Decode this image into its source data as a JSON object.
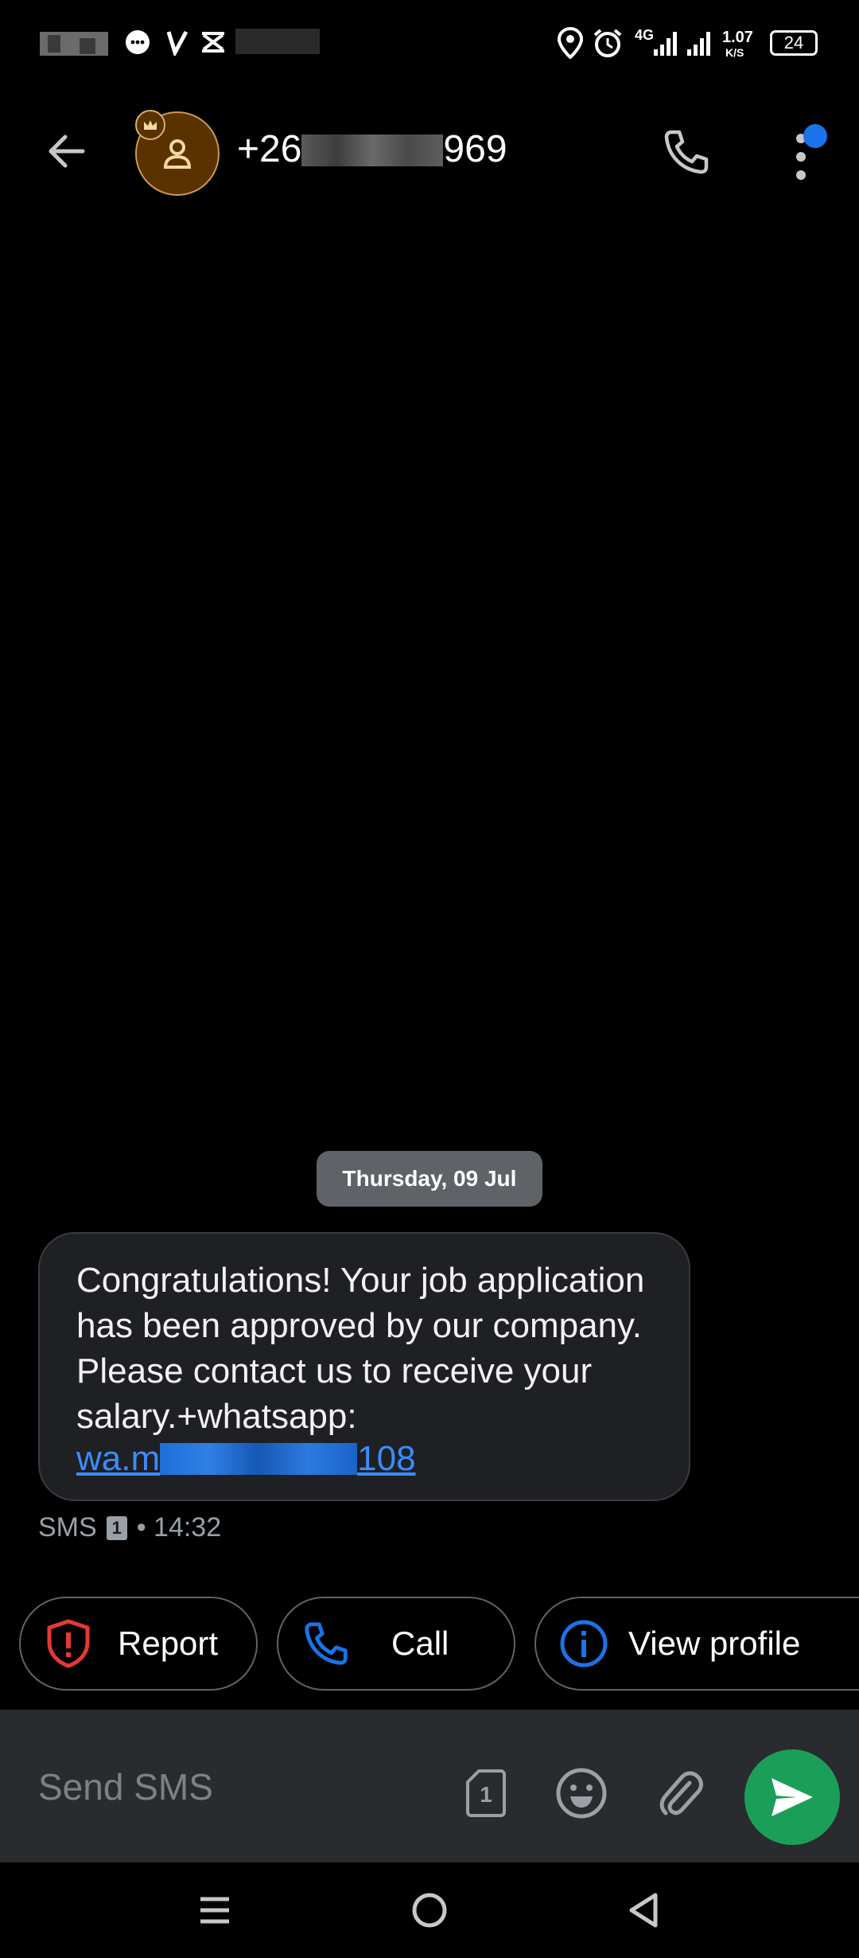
{
  "status_bar": {
    "network": "4G",
    "speed_value": "1.07",
    "speed_unit": "K/S",
    "battery": "24"
  },
  "header": {
    "contact_number_start": "+26",
    "contact_number_end": "969"
  },
  "conversation": {
    "date_chip": "Thursday, 09 Jul",
    "message": {
      "text": "Congratulations! Your job application has been approved by our company. Please contact us to receive your salary.+whatsapp:",
      "link_start": "wa.m",
      "link_end": "108",
      "meta_type": "SMS",
      "sim_slot": "1",
      "time": "• 14:32"
    }
  },
  "actions": {
    "report_label": "Report",
    "call_label": "Call",
    "view_profile_label": "View profile"
  },
  "compose": {
    "placeholder": "Send SMS",
    "sim_slot": "1"
  },
  "colors": {
    "accent_blue": "#3b8cff",
    "send_green": "#1b9f58",
    "report_red": "#e53935",
    "avatar_brown": "#5a3200"
  },
  "icons": [
    "back-arrow-icon",
    "person-icon",
    "crown-icon",
    "phone-icon",
    "more-vert-icon",
    "shield-alert-icon",
    "info-icon",
    "sim-icon",
    "emoji-icon",
    "attachment-icon",
    "send-icon",
    "menu-icon",
    "home-icon",
    "back-triangle-icon"
  ]
}
